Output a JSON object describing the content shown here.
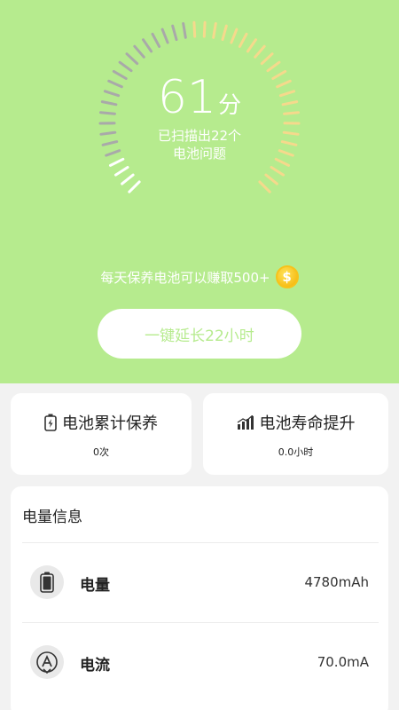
{
  "hero": {
    "score": "61",
    "score_unit": "分",
    "scan_line1": "已扫描出22个",
    "scan_line2": "电池问题",
    "earn_text": "每天保养电池可以赚取500+",
    "coin_symbol": "$",
    "extend_button": "一键延长22小时",
    "score_fraction": 0.61,
    "colors": {
      "background": "#b6eb8e",
      "tick_gray": "#a9a9a9",
      "tick_yellow": "#f5d98c",
      "tick_light": "#ffffff"
    }
  },
  "stats": [
    {
      "title": "电池累计保养",
      "value": "0次",
      "icon": "battery-charging-icon"
    },
    {
      "title": "电池寿命提升",
      "value": "0.0小时",
      "icon": "signal-bars-icon"
    }
  ],
  "info": {
    "title": "电量信息",
    "rows": [
      {
        "label": "电量",
        "value": "4780mAh",
        "icon": "battery-icon"
      },
      {
        "label": "电流",
        "value": "70.0mA",
        "icon": "current-icon"
      }
    ]
  }
}
